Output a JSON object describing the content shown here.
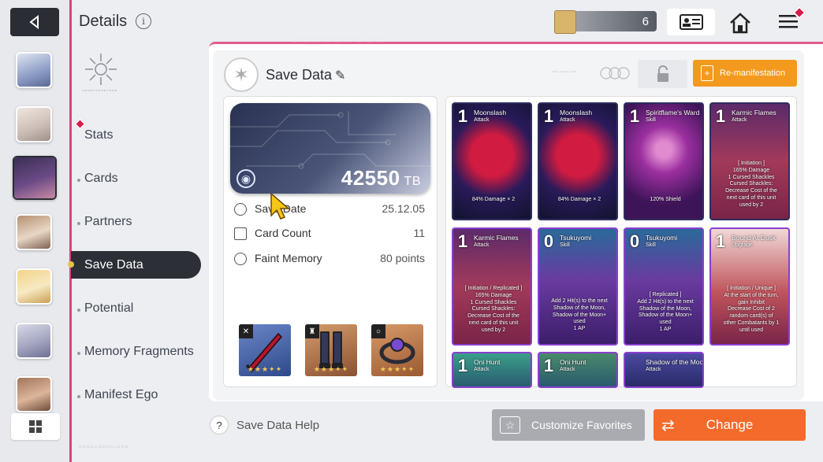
{
  "header": {
    "title": "Details",
    "currency_value": "6"
  },
  "nav": {
    "items": [
      {
        "label": "Stats"
      },
      {
        "label": "Cards"
      },
      {
        "label": "Partners"
      },
      {
        "label": "Save Data"
      },
      {
        "label": "Potential"
      },
      {
        "label": "Memory Fragments"
      },
      {
        "label": "Manifest Ego"
      }
    ],
    "active": "Save Data"
  },
  "panel": {
    "title": "Save Data",
    "remanifest_label": "Re-manifestation",
    "tb_value": "42550",
    "tb_unit": "TB",
    "stats": [
      {
        "label": "Save Date",
        "value": "25.12.05",
        "icon": "clock-icon"
      },
      {
        "label": "Card Count",
        "value": "11",
        "icon": "card-icon"
      },
      {
        "label": "Faint Memory",
        "value": "80 points",
        "icon": "brain-icon"
      }
    ],
    "equipment": [
      {
        "name": "weapon",
        "stars": "★★★✦✦"
      },
      {
        "name": "boots",
        "stars": "★★★✦✦"
      },
      {
        "name": "ring",
        "stars": "★★★✦✦"
      }
    ]
  },
  "cards": [
    {
      "cost": "1",
      "name": "Moonslash",
      "type": "Attack",
      "desc": "84% Damage × 2"
    },
    {
      "cost": "1",
      "name": "Moonslash",
      "type": "Attack",
      "desc": "84% Damage × 2"
    },
    {
      "cost": "1",
      "name": "Spiritflame's Ward",
      "type": "Skill",
      "desc": "120% Shield"
    },
    {
      "cost": "1",
      "name": "Karmic Flames",
      "type": "Attack",
      "desc": "[ Initiation ]\n165% Damage\n1 Cursed Shackles\nCursed Shackles:\nDecrease Cost of the\nnext card of this unit\nused by 2"
    },
    {
      "cost": "1",
      "name": "Karmic Flames",
      "type": "Attack",
      "desc": "[ Initiation / Replicated ]\n165% Damage\n1 Cursed Shackles\nCursed Shackles:\nDecrease Cost of the\nnext card of this unit\nused by 2"
    },
    {
      "cost": "0",
      "name": "Tsukuyomi",
      "type": "Skill",
      "desc": "Add 2 Hit(s) to the next\nShadow of the Moon,\nShadow of the Moon+\nused\n1 AP"
    },
    {
      "cost": "0",
      "name": "Tsukuyomi",
      "type": "Skill",
      "desc": "[ Replicated ]\nAdd 2 Hit(s) to the next\nShadow of the Moon,\nShadow of the Moon+\nused\n1 AP"
    },
    {
      "cost": "1",
      "name": "Bound At Dusk",
      "type": "Upgrade",
      "desc": "[ Initiation / Unique ]\nAt the start of the turn,\ngain Inhibit\nDecrease Cost of 2\nrandom card(s) of\nother Combatants by 1\nuntil used"
    },
    {
      "cost": "1",
      "name": "Oni Hunt",
      "type": "Attack",
      "desc": ""
    },
    {
      "cost": "1",
      "name": "Oni Hunt",
      "type": "Attack",
      "desc": ""
    },
    {
      "cost": "",
      "name": "Shadow of the Moon",
      "type": "Attack",
      "desc": ""
    }
  ],
  "footer": {
    "help_label": "Save Data Help",
    "customize_label": "Customize Favorites",
    "change_label": "Change"
  },
  "colors": {
    "accent": "#d8457f",
    "orange": "#f39a1e",
    "change": "#f36a2a",
    "dark": "#2c2f36"
  }
}
